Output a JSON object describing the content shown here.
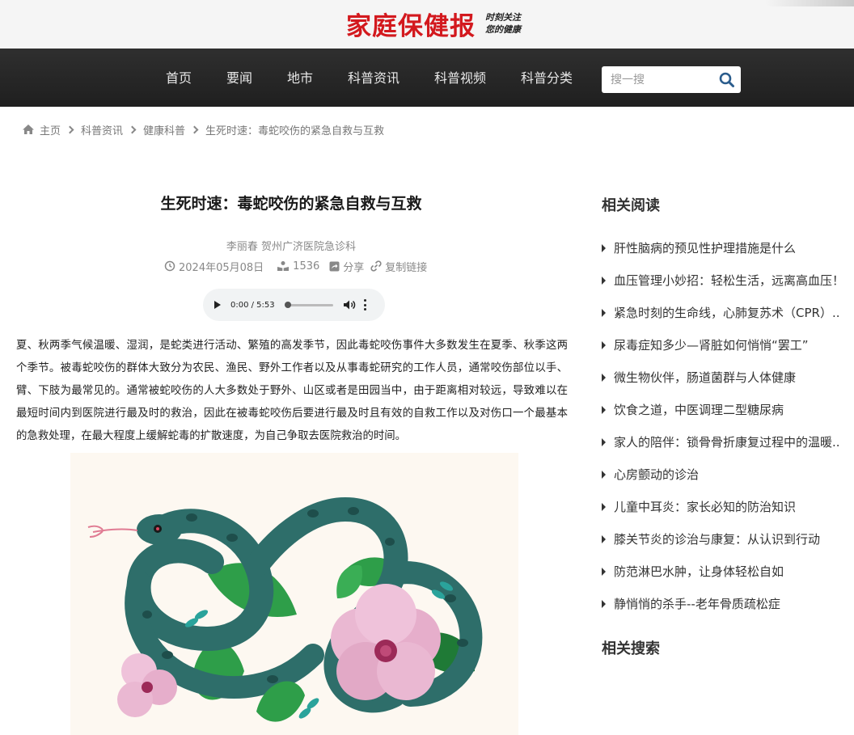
{
  "site": {
    "logo_text": "家庭保健报",
    "slogan_line1": "时刻关注",
    "slogan_line2": "您的健康",
    "brand_color": "#d3191e"
  },
  "nav": {
    "items": [
      "首页",
      "要闻",
      "地市",
      "科普资讯",
      "科普视频",
      "科普分类"
    ],
    "search_placeholder": "搜一搜",
    "search_icon": "search-icon"
  },
  "breadcrumb": {
    "home_icon": "home-icon",
    "items": [
      "主页",
      "科普资讯",
      "健康科普",
      "生死时速：毒蛇咬伤的紧急自救与互救"
    ]
  },
  "article": {
    "title": "生死时速：毒蛇咬伤的紧急自救与互救",
    "author": "李丽春  贺州广济医院急诊科",
    "date": "2024年05月08日",
    "views": "1536",
    "share_label": "分享",
    "copy_link_label": "复制链接",
    "audio_time": "0:00 / 5:53",
    "audio_progress": 0,
    "body": "夏、秋两季气候温暖、湿润，是蛇类进行活动、繁殖的高发季节，因此毒蛇咬伤事件大多数发生在夏季、秋季这两个季节。被毒蛇咬伤的群体大致分为农民、渔民、野外工作者以及从事毒蛇研究的工作人员，通常咬伤部位以手、臂、下肢为最常见的。通常被蛇咬伤的人大多数处于野外、山区或者是田园当中，由于距离相对较远，导致难以在最短时间内到医院进行最及时的救治，因此在被毒蛇咬伤后要进行最及时且有效的自救工作以及对伤口一个最基本的急救处理，在最大程度上缓解蛇毒的扩散速度，为自己争取去医院救治的时间。"
  },
  "sidebar": {
    "related_reading_title": "相关阅读",
    "related": [
      "肝性脑病的预见性护理措施是什么",
      "血压管理小妙招：轻松生活，远离高血压！",
      "紧急时刻的生命线，心肺复苏术（CPR）..",
      "尿毒症知多少—肾脏如何悄悄“罢工”",
      "微生物伙伴，肠道菌群与人体健康",
      "饮食之道，中医调理二型糖尿病",
      "家人的陪伴：锁骨骨折康复过程中的温暖..",
      "心房颤动的诊治",
      "儿童中耳炎：家长必知的防治知识",
      "膝关节炎的诊治与康复：从认识到行动",
      "防范淋巴水肿，让身体轻松自如",
      "静悄悄的杀手--老年骨质疏松症"
    ],
    "related_search_title": "相关搜索"
  }
}
